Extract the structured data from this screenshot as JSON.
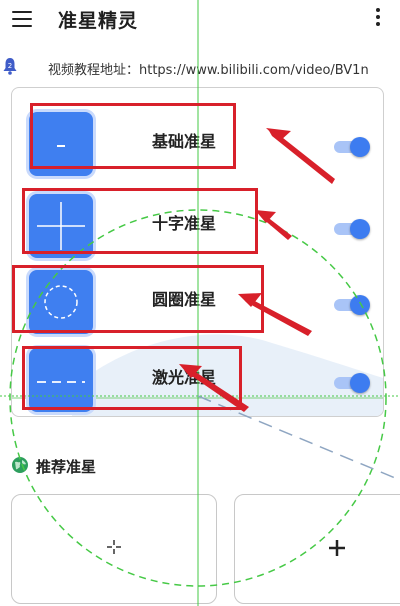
{
  "appbar": {
    "title": "准星精灵"
  },
  "notice": {
    "text": "视频教程地址：https://www.bilibili.com/video/BV1n"
  },
  "crosshairs": [
    {
      "label": "基础准星",
      "enabled": true
    },
    {
      "label": "十字准星",
      "enabled": true
    },
    {
      "label": "圆圈准星",
      "enabled": true
    },
    {
      "label": "激光准星",
      "enabled": true
    }
  ],
  "section": {
    "title": "推荐准星"
  },
  "colors": {
    "accent": "#3f7ff0",
    "highlight": "#d8202a",
    "overlay_line": "#46c946"
  },
  "icons": [
    "menu-icon",
    "more-vert-icon",
    "bell-icon",
    "globe-icon",
    "crosshair-icon",
    "plus-icon"
  ]
}
